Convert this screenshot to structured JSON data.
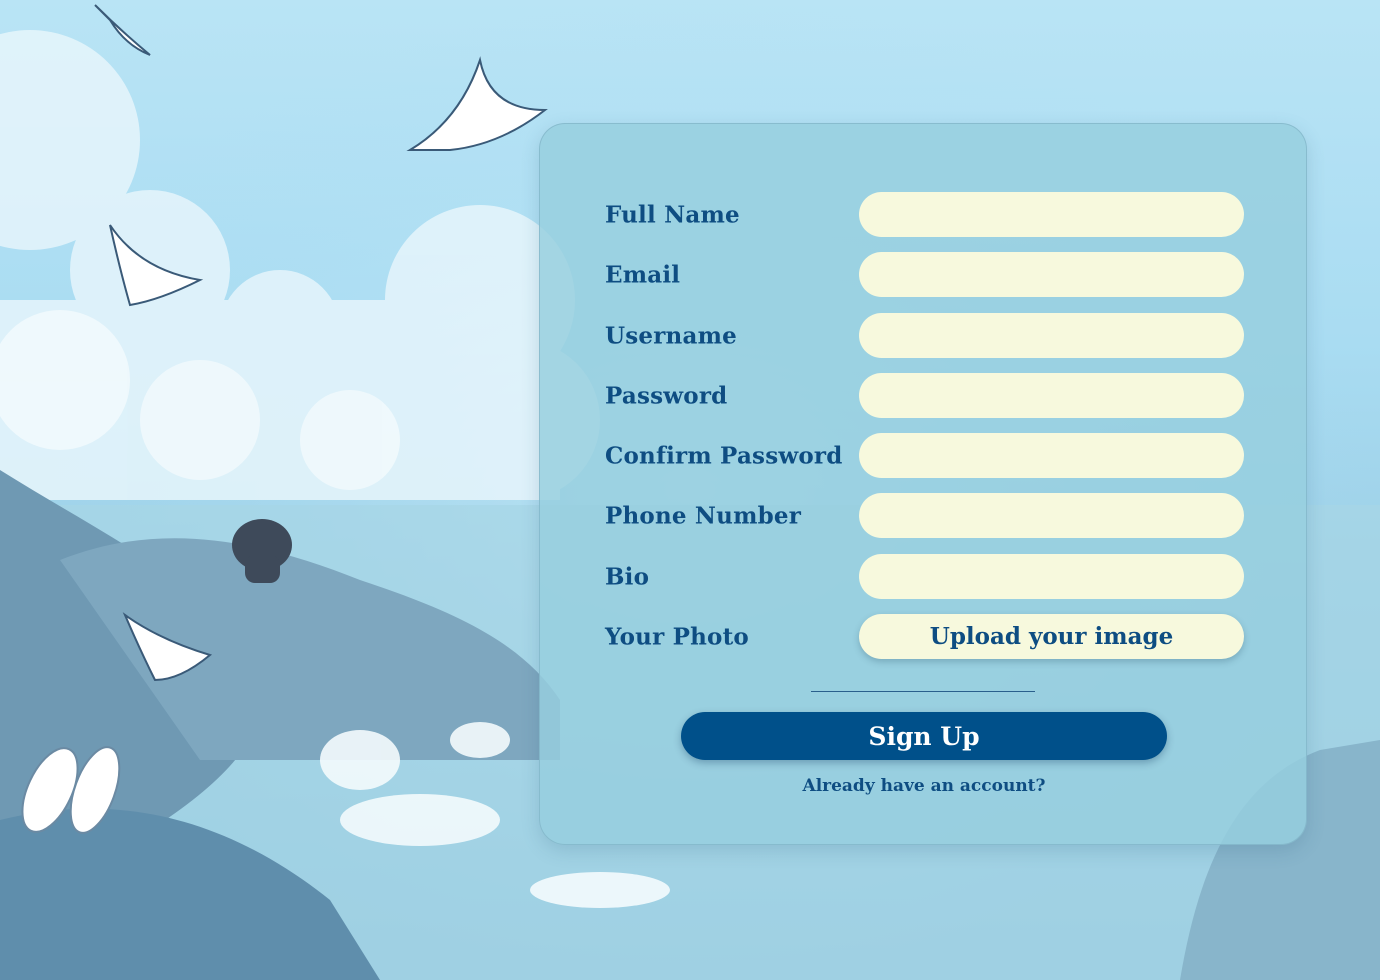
{
  "form": {
    "fields": [
      {
        "label": "Full Name",
        "value": ""
      },
      {
        "label": "Email",
        "value": ""
      },
      {
        "label": "Username",
        "value": ""
      },
      {
        "label": "Password",
        "value": ""
      },
      {
        "label": "Confirm Password",
        "value": ""
      },
      {
        "label": "Phone Number",
        "value": ""
      },
      {
        "label": "Bio",
        "value": ""
      }
    ],
    "photo": {
      "label": "Your Photo",
      "upload_label": "Upload your image"
    },
    "submit_label": "Sign Up",
    "login_link": "Already have an account?"
  },
  "colors": {
    "label": "#0e4d82",
    "field_bg": "#f7f9dd",
    "button_bg": "#00508a",
    "card_bg": "#96cede"
  }
}
